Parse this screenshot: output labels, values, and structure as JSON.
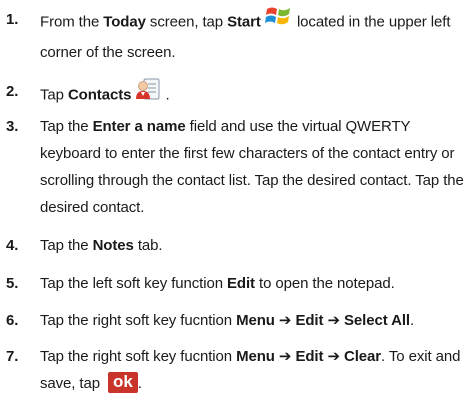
{
  "steps": [
    {
      "num": "1.",
      "a": "From the ",
      "b1": "Today",
      "c": " screen, tap ",
      "b2": "Start",
      "d": " located in the upper left corner of the screen."
    },
    {
      "num": "2.",
      "a": "Tap ",
      "b1": "Contacts",
      "c": " ."
    },
    {
      "num": "3.",
      "a": "Tap the ",
      "b1": "Enter a name",
      "c": " field and use the virtual QWERTY keyboard to enter the first few characters of the contact entry or scrolling through the contact list. Tap the desired contact. Tap the desired contact."
    },
    {
      "num": "4.",
      "a": "Tap the ",
      "b1": "Notes",
      "c": " tab."
    },
    {
      "num": "5.",
      "a": "Tap the left soft key function ",
      "b1": "Edit",
      "c": " to open the notepad."
    },
    {
      "num": "6.",
      "a": "Tap the right soft key fucntion ",
      "b1": "Menu",
      "arrow1": " ➔ ",
      "b2": "Edit",
      "arrow2": " ➔ ",
      "b3": "Select All",
      "end": "."
    },
    {
      "num": "7.",
      "a": "Tap the right soft key fucntion ",
      "b1": "Menu",
      "arrow1": " ➔ ",
      "b2": "Edit",
      "arrow2": " ➔ ",
      "b3": "Clear",
      "end": ". To exit and save, tap ",
      "ok": "ok",
      "end2": "."
    }
  ],
  "icons": {
    "start": "windows-start-icon",
    "contacts": "contacts-icon"
  },
  "colors": {
    "ok_button": "#c9342a",
    "text": "#1a1a1a"
  }
}
